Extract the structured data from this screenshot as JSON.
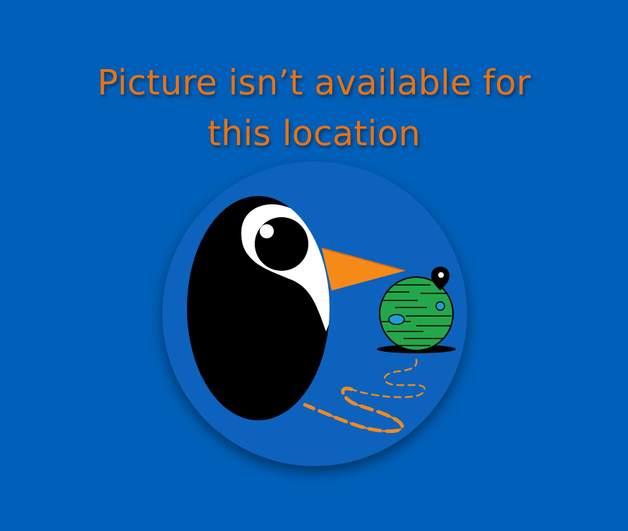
{
  "message": {
    "line1": "Picture isn’t available for",
    "line2": "this location"
  },
  "illustration": {
    "subject": "penguin-looking-at-globe",
    "icons": [
      "penguin-icon",
      "globe-icon",
      "location-pin-icon",
      "dashed-path-icon"
    ]
  },
  "colors": {
    "background": "#005fb8",
    "circle": "#0a62bd",
    "message_text": "#e87314",
    "beak": "#f58a18",
    "globe": "#23a74a",
    "globe_water": "#1e9bd8",
    "path": "#f08a1e",
    "black": "#000000",
    "white": "#ffffff"
  }
}
